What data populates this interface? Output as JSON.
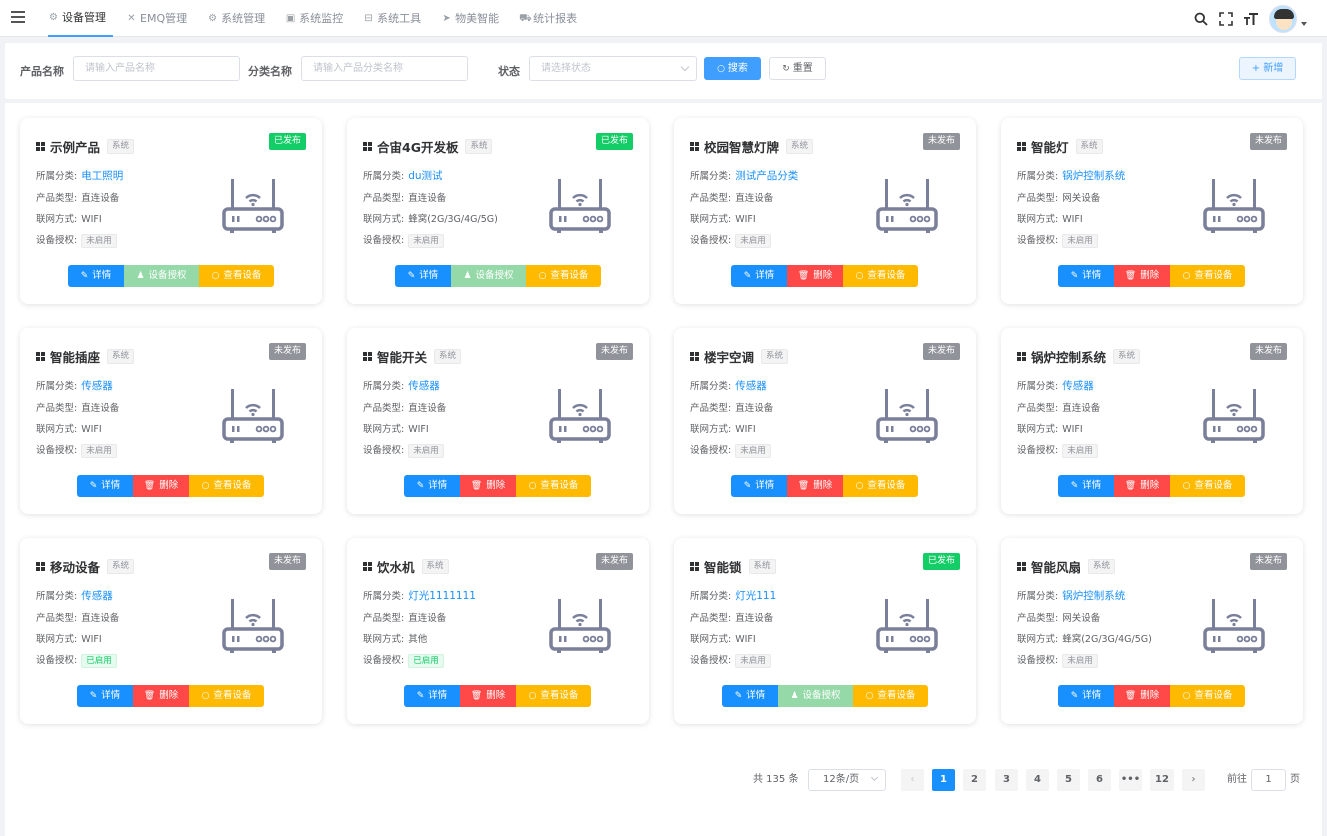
{
  "nav": {
    "items": [
      {
        "icon": "⚙",
        "icon_name": "gear-icon",
        "label": "设备管理",
        "active": true
      },
      {
        "icon": "✕",
        "icon_name": "emq-icon",
        "label": "EMQ管理"
      },
      {
        "icon": "⚙",
        "icon_name": "gear-icon",
        "label": "系统管理"
      },
      {
        "icon": "▣",
        "icon_name": "monitor-icon",
        "label": "系统监控"
      },
      {
        "icon": "⊟",
        "icon_name": "tool-icon",
        "label": "系统工具"
      },
      {
        "icon": "➤",
        "icon_name": "send-icon",
        "label": "物美智能"
      },
      {
        "icon": "⛟",
        "icon_name": "chart-icon",
        "label": "统计报表"
      }
    ]
  },
  "search": {
    "product_label": "产品名称",
    "product_placeholder": "请输入产品名称",
    "category_label": "分类名称",
    "category_placeholder": "请输入产品分类名称",
    "status_label": "状态",
    "status_placeholder": "请选择状态",
    "search_btn": "搜索",
    "reset_btn": "重置",
    "add_btn": "+ 新增"
  },
  "labels": {
    "category": "所属分类:",
    "type": "产品类型:",
    "network": "联网方式:",
    "auth": "设备授权:",
    "sys_tag": "系统",
    "btn_detail": "详情",
    "btn_auth": "设备授权",
    "btn_delete": "删除",
    "btn_view": "查看设备"
  },
  "cards": [
    {
      "name": "示例产品",
      "status": "已发布",
      "published": true,
      "category": "电工照明",
      "type": "直连设备",
      "network": "WIFI",
      "auth": "未启用",
      "auth_on": false,
      "second_btn": "auth"
    },
    {
      "name": "合宙4G开发板",
      "status": "已发布",
      "published": true,
      "category": "du测试",
      "type": "直连设备",
      "network": "蜂窝(2G/3G/4G/5G)",
      "auth": "未启用",
      "auth_on": false,
      "second_btn": "auth"
    },
    {
      "name": "校园智慧灯牌",
      "status": "未发布",
      "published": false,
      "category": "测试产品分类",
      "type": "直连设备",
      "network": "WIFI",
      "auth": "未启用",
      "auth_on": false,
      "second_btn": "delete"
    },
    {
      "name": "智能灯",
      "status": "未发布",
      "published": false,
      "category": "锅炉控制系统",
      "type": "网关设备",
      "network": "WIFI",
      "auth": "未启用",
      "auth_on": false,
      "second_btn": "delete"
    },
    {
      "name": "智能插座",
      "status": "未发布",
      "published": false,
      "category": "传感器",
      "type": "直连设备",
      "network": "WIFI",
      "auth": "未启用",
      "auth_on": false,
      "second_btn": "delete"
    },
    {
      "name": "智能开关",
      "status": "未发布",
      "published": false,
      "category": "传感器",
      "type": "直连设备",
      "network": "WIFI",
      "auth": "未启用",
      "auth_on": false,
      "second_btn": "delete"
    },
    {
      "name": "楼宇空调",
      "status": "未发布",
      "published": false,
      "category": "传感器",
      "type": "直连设备",
      "network": "WIFI",
      "auth": "未启用",
      "auth_on": false,
      "second_btn": "delete"
    },
    {
      "name": "锅炉控制系统",
      "status": "未发布",
      "published": false,
      "category": "传感器",
      "type": "直连设备",
      "network": "WIFI",
      "auth": "未启用",
      "auth_on": false,
      "second_btn": "delete"
    },
    {
      "name": "移动设备",
      "status": "未发布",
      "published": false,
      "category": "传感器",
      "type": "直连设备",
      "network": "WIFI",
      "auth": "已启用",
      "auth_on": true,
      "second_btn": "delete"
    },
    {
      "name": "饮水机",
      "status": "未发布",
      "published": false,
      "category": "灯光1111111",
      "type": "直连设备",
      "network": "其他",
      "auth": "已启用",
      "auth_on": true,
      "second_btn": "delete"
    },
    {
      "name": "智能锁",
      "status": "已发布",
      "published": true,
      "category": "灯光111",
      "type": "直连设备",
      "network": "WIFI",
      "auth": "未启用",
      "auth_on": false,
      "second_btn": "auth"
    },
    {
      "name": "智能风扇",
      "status": "未发布",
      "published": false,
      "category": "锅炉控制系统",
      "type": "网关设备",
      "network": "蜂窝(2G/3G/4G/5G)",
      "auth": "未启用",
      "auth_on": false,
      "second_btn": "delete"
    }
  ],
  "pagination": {
    "total": "共 135 条",
    "page_size": "12条/页",
    "pages": [
      "1",
      "2",
      "3",
      "4",
      "5",
      "6",
      "•••",
      "12"
    ],
    "current": "1",
    "goto_label": "前往",
    "goto_value": "1",
    "goto_suffix": "页"
  },
  "colors": {
    "primary": "#1890ff",
    "success": "#13ce66",
    "danger": "#ff4949",
    "warning": "#ffba00",
    "info": "#909399"
  }
}
